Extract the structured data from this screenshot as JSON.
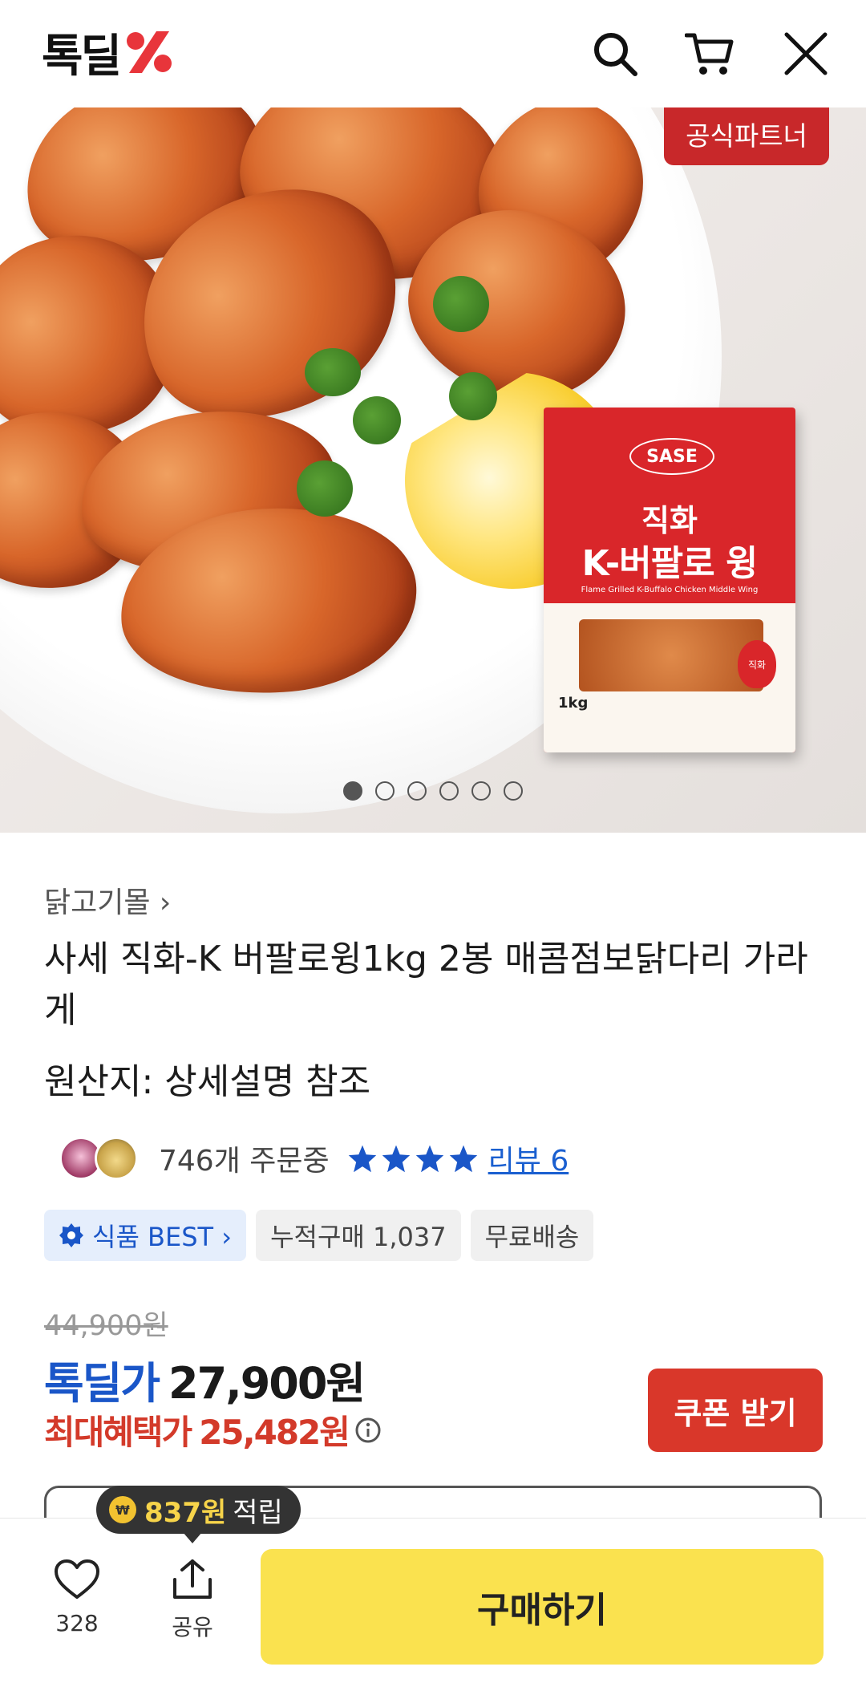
{
  "header": {
    "logo_text": "톡딜",
    "icons": [
      "search-icon",
      "cart-icon",
      "close-icon"
    ],
    "accent": "#e8353b"
  },
  "hero": {
    "partner_badge": "공식파트너",
    "package": {
      "brand": "SASE",
      "line1": "직화",
      "line2": "K-버팔로 윙",
      "subtitle": "Flame Grilled K-Buffalo Chicken Middle Wing",
      "weight": "1kg",
      "flame_label": "직화"
    },
    "slide_count": 6,
    "active_slide": 1
  },
  "product": {
    "store": "닭고기몰 ›",
    "title": "사세 직화-K 버팔로윙1kg 2봉 매콤점보닭다리 가라게",
    "origin": "원산지: 상세설명 참조",
    "orders": "746개 주문중",
    "rating_stars": 4,
    "review_link": "리뷰 6",
    "chips": [
      "식품 BEST ›",
      "누적구매 1,037",
      "무료배송"
    ]
  },
  "price": {
    "original": "44,900원",
    "deal_label": "톡딜가",
    "deal_price": "27,900원",
    "max_label": "최대혜택가",
    "max_price": "25,482원",
    "coupon_button": "쿠폰 받기",
    "colors": {
      "deal": "#1a56c8",
      "max": "#d33a2a",
      "coupon": "#d9372a"
    }
  },
  "points_tooltip": {
    "amount": "837원",
    "suffix": "적립"
  },
  "bottom_bar": {
    "like_count": "328",
    "share_label": "공유",
    "buy_button": "구매하기",
    "buy_color": "#fae24f"
  }
}
